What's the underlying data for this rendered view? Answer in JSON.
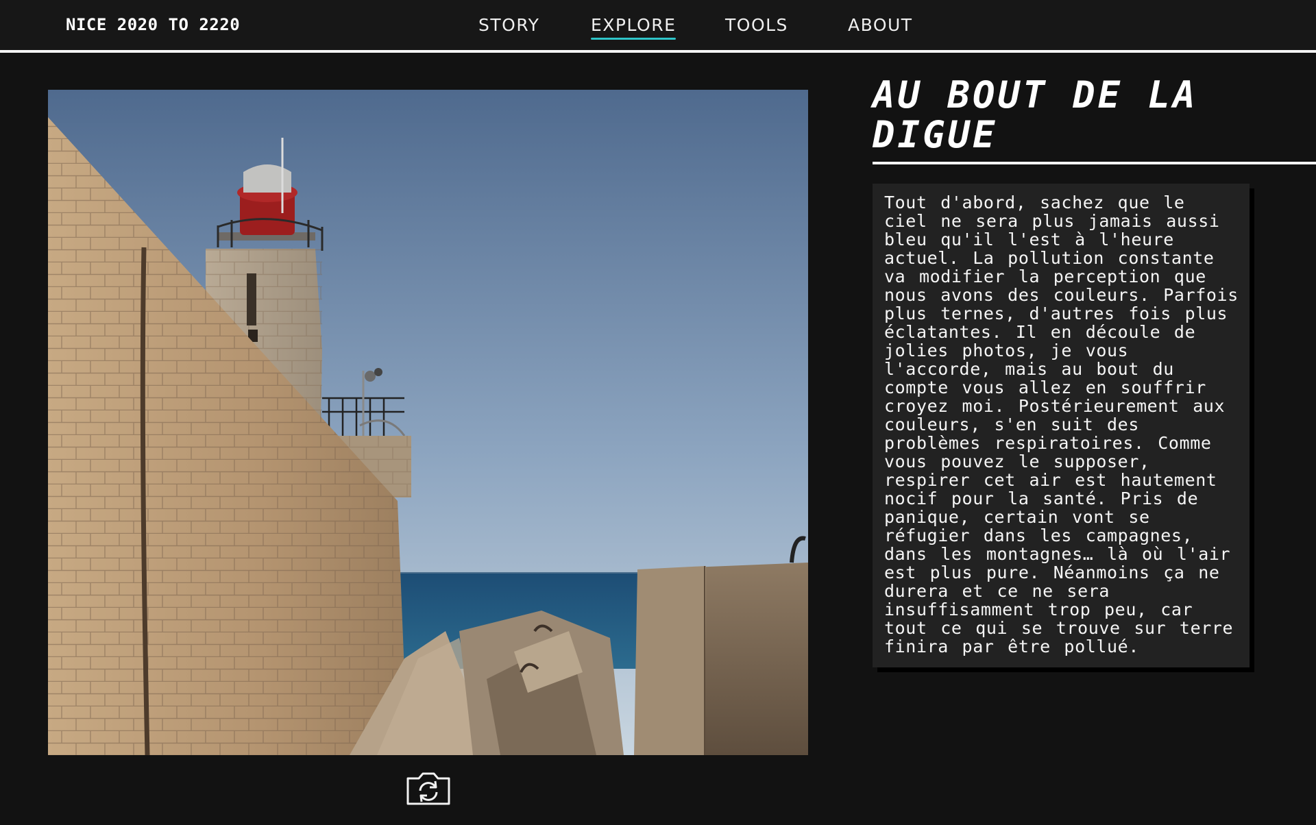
{
  "header": {
    "brand": "NICE 2020 TO 2220",
    "nav": [
      {
        "label": "STORY",
        "active": false
      },
      {
        "label": "EXPLORE",
        "active": true
      },
      {
        "label": "TOOLS",
        "active": false
      },
      {
        "label": "ABOUT",
        "active": false
      }
    ],
    "accent_color": "#2ec4c8"
  },
  "main": {
    "title": "AU BOUT DE LA DIGUE",
    "body": "Tout d'abord, sachez que le ciel ne sera plus jamais aussi bleu qu'il l'est à l'heure actuel. La pollution constante va modifier la perception que nous avons des couleurs. Parfois plus ternes, d'autres fois plus éclatantes. Il en découle de jolies photos, je vous l'accorde, mais au bout du compte vous allez en souffrir croyez moi. Postérieurement aux couleurs, s'en suit des problèmes respiratoires. Comme vous pouvez le supposer, respirer cet air est hautement nocif pour la santé. Pris de panique, certain vont se réfugier dans les campagnes, dans les montagnes… là où l'air est plus pure. Néanmoins ça ne durera et ce ne sera insuffisamment trop peu, car tout ce qui se trouve sur terre finira par être pollué.",
    "refresh_icon": "camera-switch-icon"
  }
}
